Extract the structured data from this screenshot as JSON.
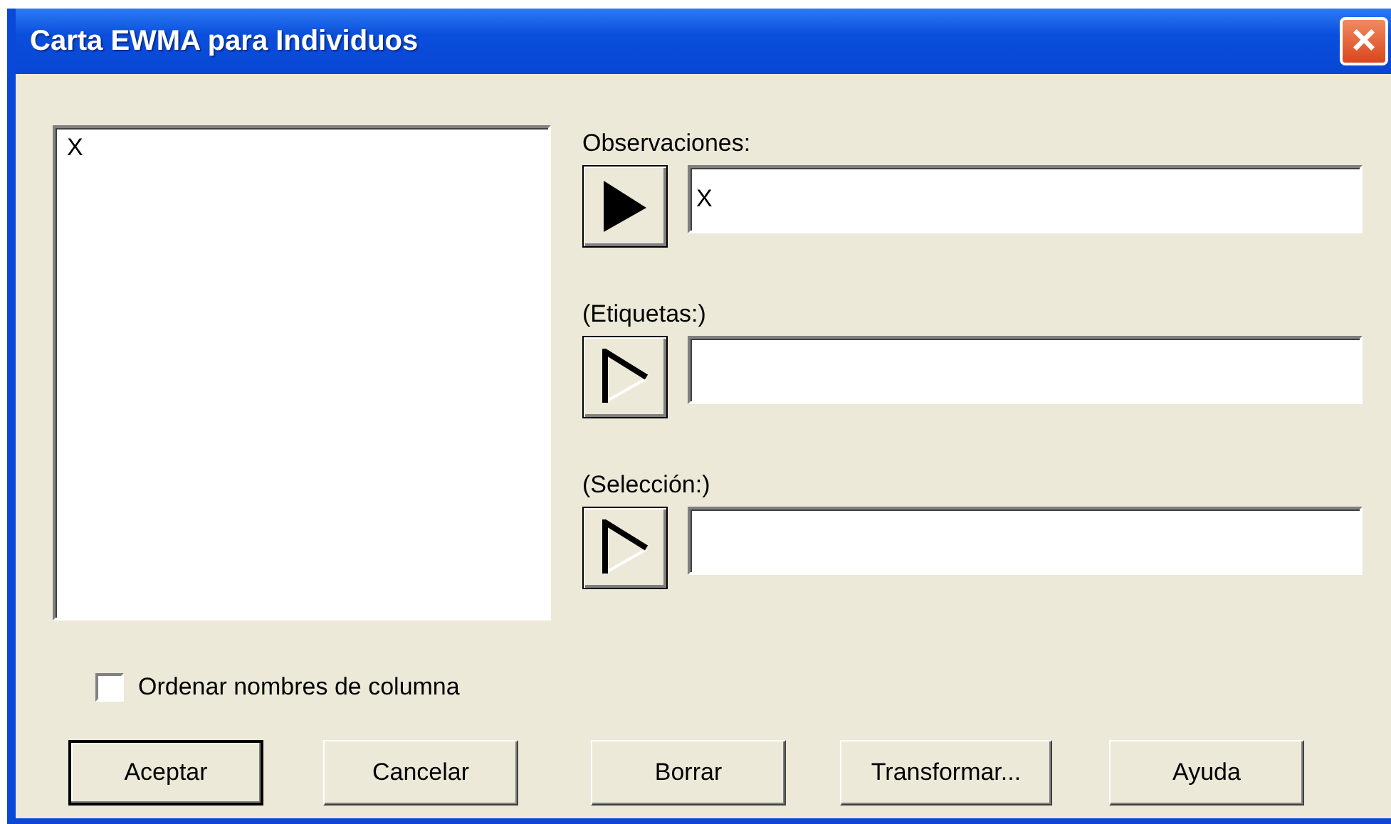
{
  "window": {
    "title": "Carta EWMA para Individuos",
    "close": "×"
  },
  "variable_list": {
    "items": [
      {
        "label": "X",
        "selected": false
      }
    ]
  },
  "fields": [
    {
      "label": "Observaciones:",
      "value": "X",
      "arrow_enabled": true
    },
    {
      "label": "(Etiquetas:)",
      "arrow_enabled": false
    },
    {
      "label": "(Selección:)",
      "arrow_enabled": false
    }
  ],
  "sort_checkbox": {
    "label": "Ordenar nombres de columna",
    "checked": false
  },
  "buttons": [
    {
      "label": "Aceptar",
      "default": true
    },
    {
      "label": "Cancelar",
      "default": false
    },
    {
      "label": "Borrar",
      "default": false
    },
    {
      "label": "Transformar...",
      "default": false
    },
    {
      "label": "Ayuda",
      "default": false
    }
  ]
}
